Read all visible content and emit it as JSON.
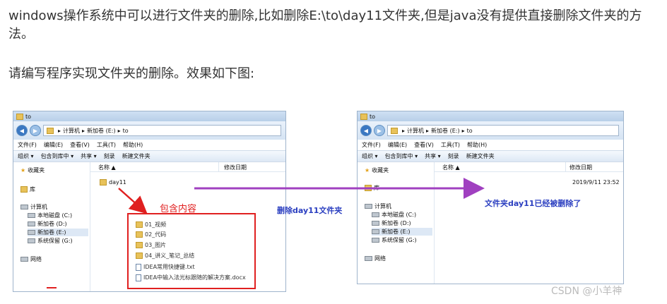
{
  "article": {
    "paragraph1": "windows操作系统中可以进行文件夹的删除,比如删除E:\\to\\day11文件夹,但是java没有提供直接删除文件夹的方法。",
    "paragraph2": "请编写程序实现文件夹的删除。效果如下图:"
  },
  "left_window": {
    "title": "to",
    "breadcrumb": [
      "计算机",
      "新加卷 (E:)",
      "to"
    ],
    "menu": [
      "文件(F)",
      "编辑(E)",
      "查看(V)",
      "工具(T)",
      "帮助(H)"
    ],
    "toolbar": [
      "组织 ▾",
      "包含到库中 ▾",
      "共享 ▾",
      "刻录",
      "新建文件夹"
    ],
    "nav": {
      "favorites": "收藏夹",
      "library": "库",
      "computer": "计算机",
      "drives": [
        "本地磁盘 (C:)",
        "新加卷 (D:)",
        "新加卷 (E:)",
        "系统保留 (G:)"
      ],
      "network": "网络"
    },
    "columns": {
      "name": "名称 ▲",
      "modified": "修改日期"
    },
    "folder": "day11",
    "contents": [
      "01_视频",
      "02_代码",
      "03_图片",
      "04_讲义_笔记_总结",
      "IDEA常用快捷键.txt",
      "IDEA中输入法光标跟随的解决方案.docx"
    ]
  },
  "right_window": {
    "title": "to",
    "breadcrumb": [
      "计算机",
      "新加卷 (E:)",
      "to"
    ],
    "menu": [
      "文件(F)",
      "编辑(E)",
      "查看(V)",
      "工具(T)",
      "帮助(H)"
    ],
    "toolbar": [
      "组织 ▾",
      "包含到库中 ▾",
      "共享 ▾",
      "刻录",
      "新建文件夹"
    ],
    "nav": {
      "favorites": "收藏夹",
      "library": "库",
      "computer": "计算机",
      "drives": [
        "本地磁盘 (C:)",
        "新加卷 (D:)",
        "新加卷 (E:)",
        "系统保留 (G:)"
      ],
      "network": "网络"
    },
    "columns": {
      "name": "名称 ▲",
      "modified": "修改日期"
    },
    "timestamp": "2019/9/11 23:52"
  },
  "annotations": {
    "contains": "包含内容",
    "delete_action": "删除day11文件夹",
    "deleted_msg": "文件夹day11已经被删除了",
    "watermark": "CSDN @小羊神"
  },
  "colors": {
    "red": "#e02020",
    "purple": "#a040c0",
    "blue_text": "#2a3ec0"
  }
}
